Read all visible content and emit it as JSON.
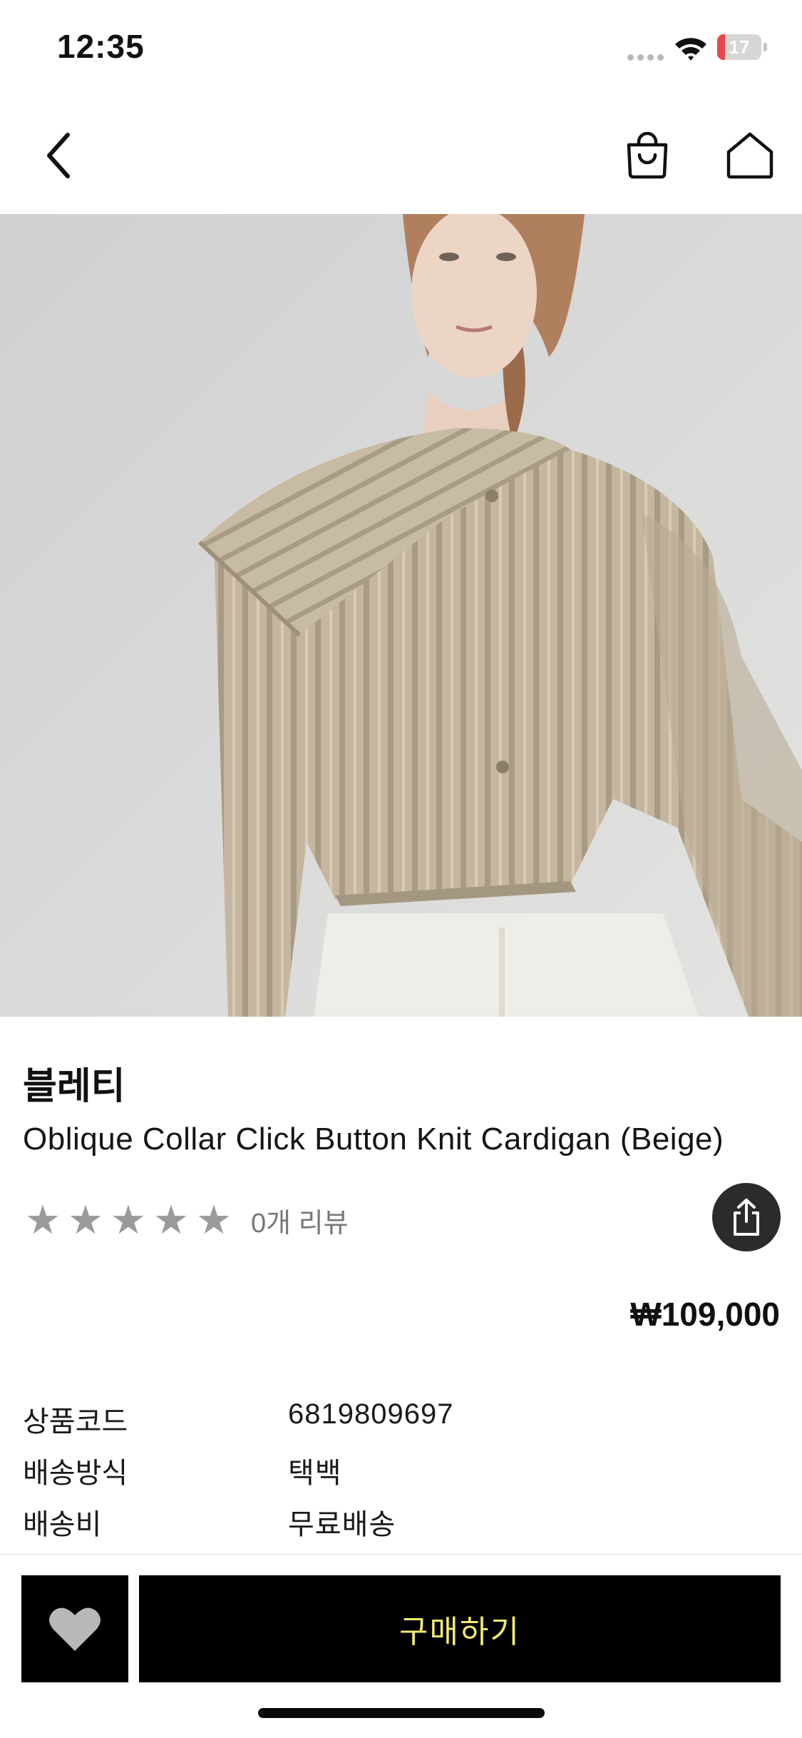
{
  "status_bar": {
    "time": "12:35",
    "battery_text": "17",
    "battery_level": 0.17,
    "battery_color": "#e5484d"
  },
  "nav": {
    "back_icon": "chevron-left-icon",
    "cart_icon": "shopping-bag-icon",
    "home_icon": "home-icon"
  },
  "product": {
    "brand": "블레티",
    "name": "Oblique Collar Click Button Knit Cardigan (Beige)",
    "rating_stars": 5,
    "rating_filled": 0,
    "review_count_label": "0개 리뷰",
    "price": "₩109,000",
    "share_icon": "share-icon"
  },
  "specs": [
    {
      "label": "상품코드",
      "value": "6819809697"
    },
    {
      "label": "배송방식",
      "value": "택백"
    },
    {
      "label": "배송비",
      "value": "무료배송"
    }
  ],
  "bottom_bar": {
    "wish_icon": "heart-icon",
    "buy_label": "구매하기",
    "buy_label_color": "#f2ea6d"
  }
}
